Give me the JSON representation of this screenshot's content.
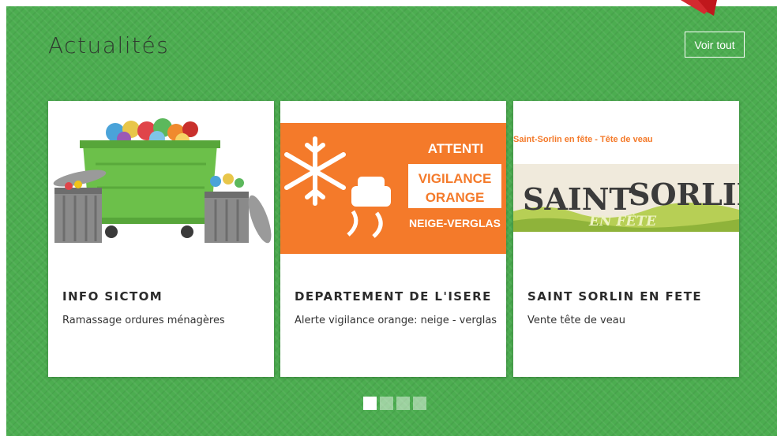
{
  "section": {
    "title": "Actualités",
    "see_all_label": "Voir tout"
  },
  "cards": [
    {
      "title": "INFO SICTOM",
      "description": "Ramassage ordures ménagères",
      "image": {
        "depicts": "dumpster-and-trash-cans"
      }
    },
    {
      "title": "DEPARTEMENT DE L'ISERE",
      "description": "Alerte vigilance orange: neige - verglas",
      "image": {
        "line1": "ATTENTI",
        "line2": "VIGILANCE",
        "line3": "ORANGE",
        "line4": "NEIGE-VERGLAS",
        "background": "#f47a2a"
      }
    },
    {
      "title": "SAINT SORLIN EN FETE",
      "description": "Vente tête de veau",
      "image": {
        "caption": "Saint-Sorlin en fête - Tête de veau",
        "banner_word1": "SAINT",
        "banner_word2": "SORLIN",
        "banner_sub": "EN FÊTE"
      }
    }
  ],
  "pager": {
    "count": 4,
    "active_index": 0
  },
  "colors": {
    "section_bg": "#4cad50",
    "alert_orange": "#f47a2a",
    "arrow_red": "#c0171c"
  }
}
